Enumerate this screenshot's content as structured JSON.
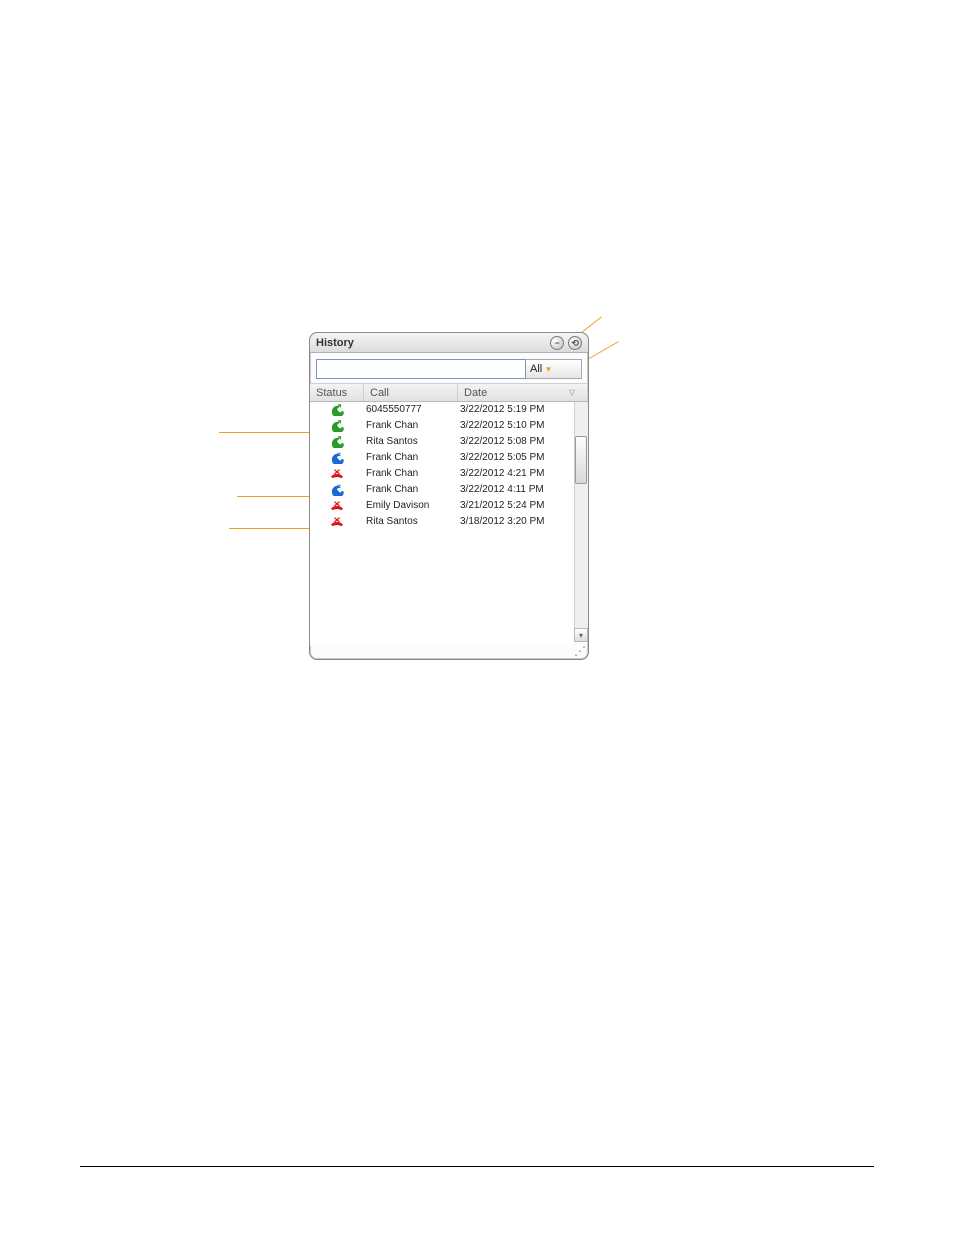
{
  "window": {
    "title": "History",
    "search_value": "",
    "filter_label": "All",
    "columns": {
      "status": "Status",
      "call": "Call",
      "date": "Date"
    },
    "rows": [
      {
        "status": "dialed",
        "call": "6045550777",
        "date": "3/22/2012 5:19 PM"
      },
      {
        "status": "dialed",
        "call": "Frank Chan",
        "date": "3/22/2012 5:10 PM"
      },
      {
        "status": "dialed",
        "call": "Rita Santos",
        "date": "3/22/2012 5:08 PM"
      },
      {
        "status": "received",
        "call": "Frank Chan",
        "date": "3/22/2012 5:05 PM"
      },
      {
        "status": "missed",
        "call": "Frank Chan",
        "date": "3/22/2012 4:21 PM"
      },
      {
        "status": "received",
        "call": "Frank Chan",
        "date": "3/22/2012 4:11 PM"
      },
      {
        "status": "missed",
        "call": "Emily Davison",
        "date": "3/21/2012 5:24 PM"
      },
      {
        "status": "missed",
        "call": "Rita Santos",
        "date": "3/18/2012 3:20 PM"
      }
    ]
  },
  "icons": {
    "dialed": "outgoing-call-icon",
    "received": "incoming-call-icon",
    "missed": "missed-call-icon"
  }
}
